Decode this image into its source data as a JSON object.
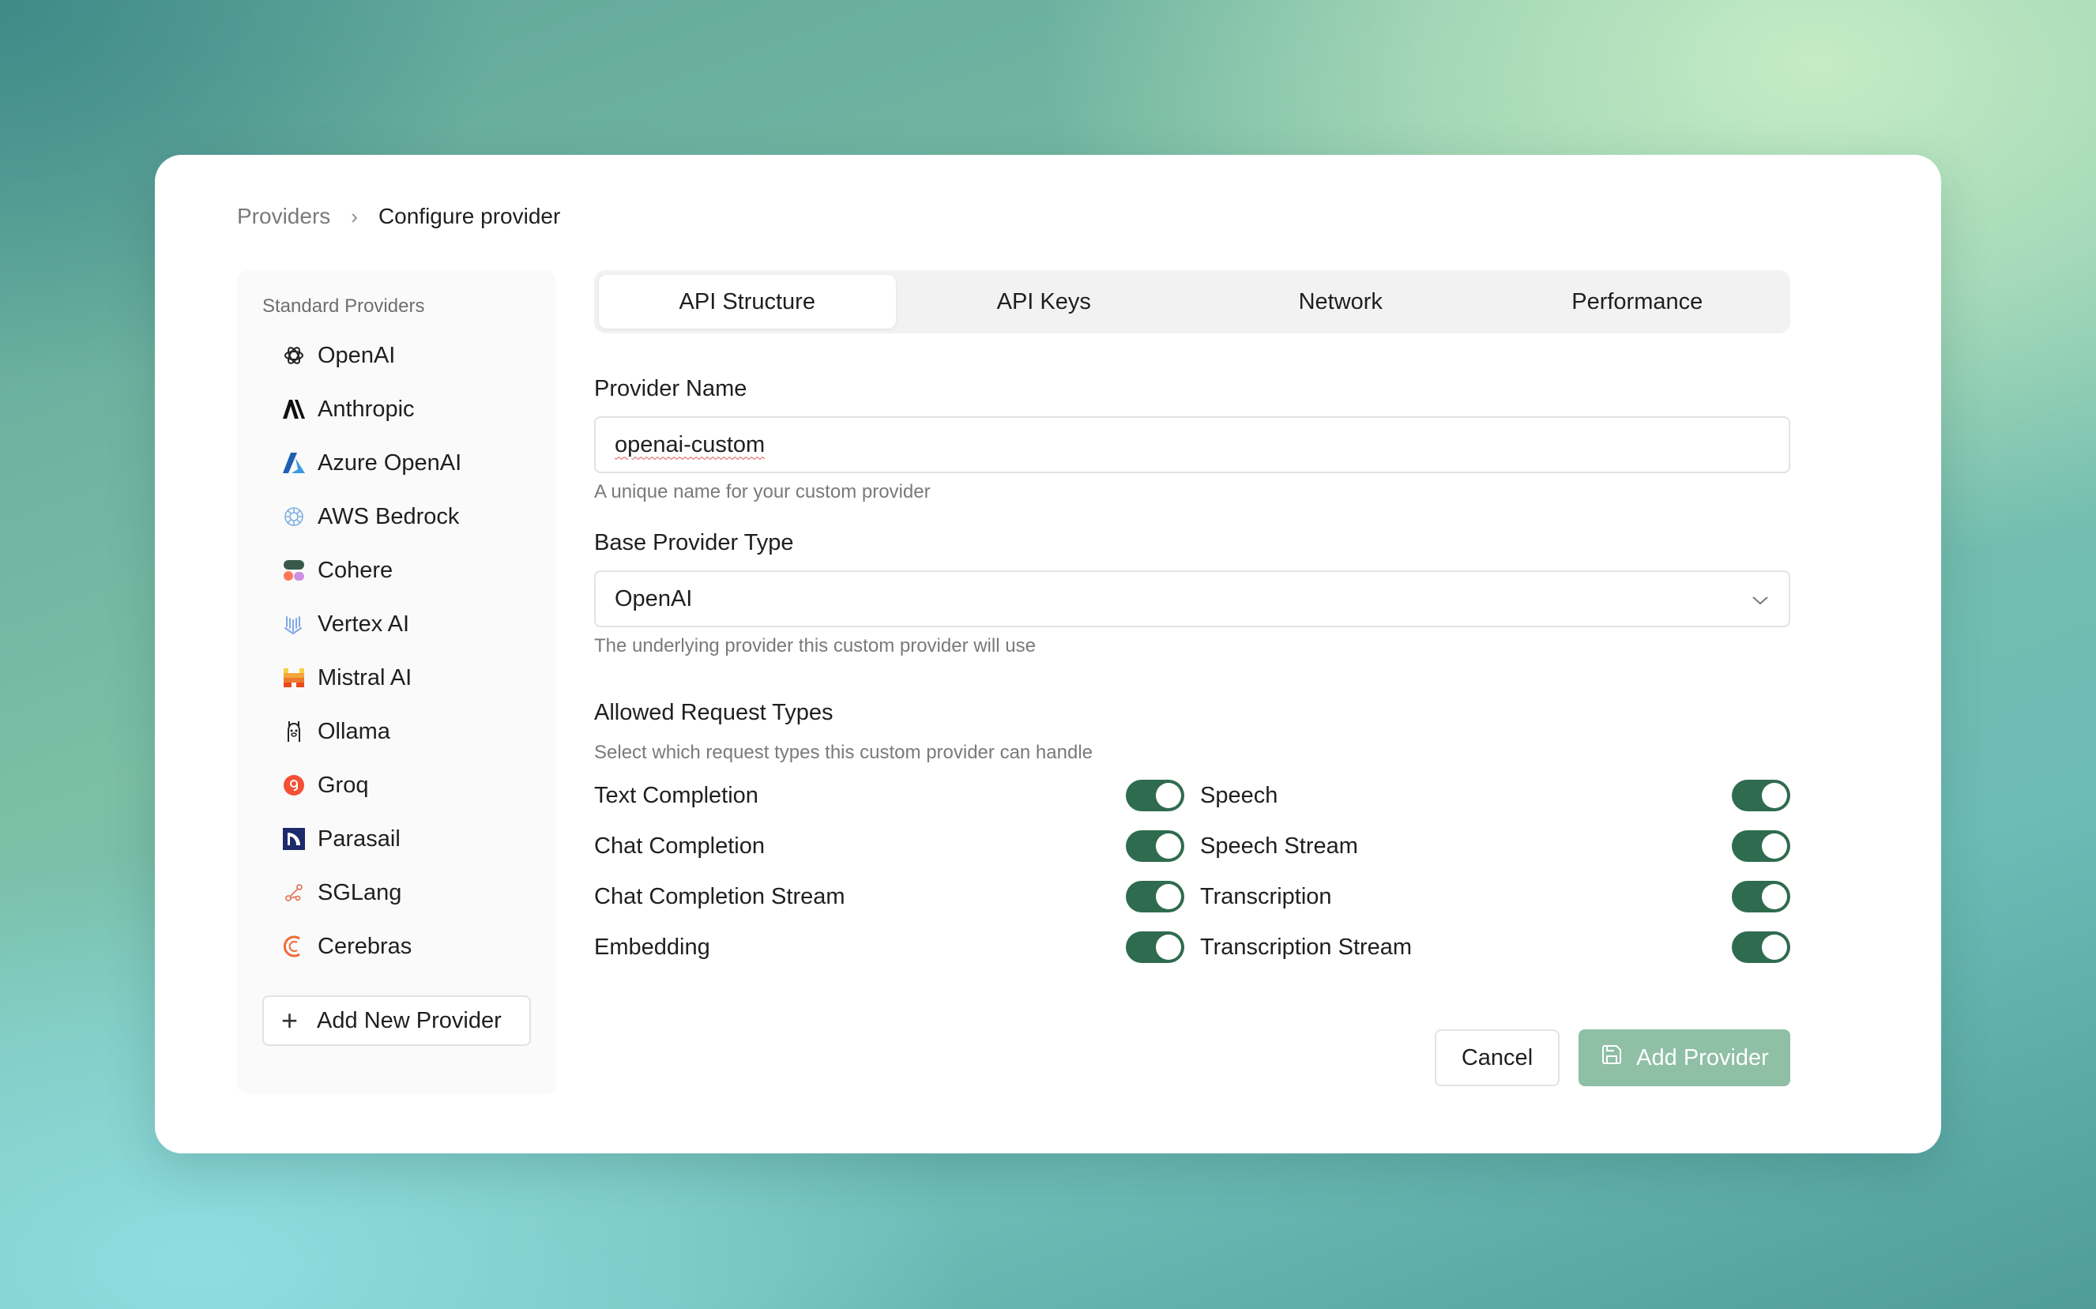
{
  "breadcrumb": {
    "root": "Providers",
    "separator": "›",
    "current": "Configure provider"
  },
  "sidebar": {
    "title": "Standard Providers",
    "items": [
      {
        "label": "OpenAI",
        "icon": "openai-icon"
      },
      {
        "label": "Anthropic",
        "icon": "anthropic-icon"
      },
      {
        "label": "Azure OpenAI",
        "icon": "azure-icon"
      },
      {
        "label": "AWS Bedrock",
        "icon": "aws-bedrock-icon"
      },
      {
        "label": "Cohere",
        "icon": "cohere-icon"
      },
      {
        "label": "Vertex AI",
        "icon": "vertex-icon"
      },
      {
        "label": "Mistral AI",
        "icon": "mistral-icon"
      },
      {
        "label": "Ollama",
        "icon": "ollama-icon"
      },
      {
        "label": "Groq",
        "icon": "groq-icon"
      },
      {
        "label": "Parasail",
        "icon": "parasail-icon"
      },
      {
        "label": "SGLang",
        "icon": "sglang-icon"
      },
      {
        "label": "Cerebras",
        "icon": "cerebras-icon"
      }
    ],
    "add_button": "Add New Provider"
  },
  "tabs": [
    {
      "label": "API Structure",
      "active": true
    },
    {
      "label": "API Keys",
      "active": false
    },
    {
      "label": "Network",
      "active": false
    },
    {
      "label": "Performance",
      "active": false
    }
  ],
  "form": {
    "provider_name": {
      "label": "Provider Name",
      "value": "openai-custom",
      "helper": "A unique name for your custom provider"
    },
    "base_type": {
      "label": "Base Provider Type",
      "value": "OpenAI",
      "helper": "The underlying provider this custom provider will use"
    },
    "request_types": {
      "title": "Allowed Request Types",
      "subtitle": "Select which request types this custom provider can handle",
      "left": [
        {
          "label": "Text Completion",
          "on": true
        },
        {
          "label": "Chat Completion",
          "on": true
        },
        {
          "label": "Chat Completion Stream",
          "on": true
        },
        {
          "label": "Embedding",
          "on": true
        }
      ],
      "right": [
        {
          "label": "Speech",
          "on": true
        },
        {
          "label": "Speech Stream",
          "on": true
        },
        {
          "label": "Transcription",
          "on": true
        },
        {
          "label": "Transcription Stream",
          "on": true
        }
      ]
    }
  },
  "actions": {
    "cancel": "Cancel",
    "submit": "Add Provider"
  },
  "colors": {
    "accent": "#2f6b4f",
    "primary_disabled": "#8fbfa5"
  }
}
